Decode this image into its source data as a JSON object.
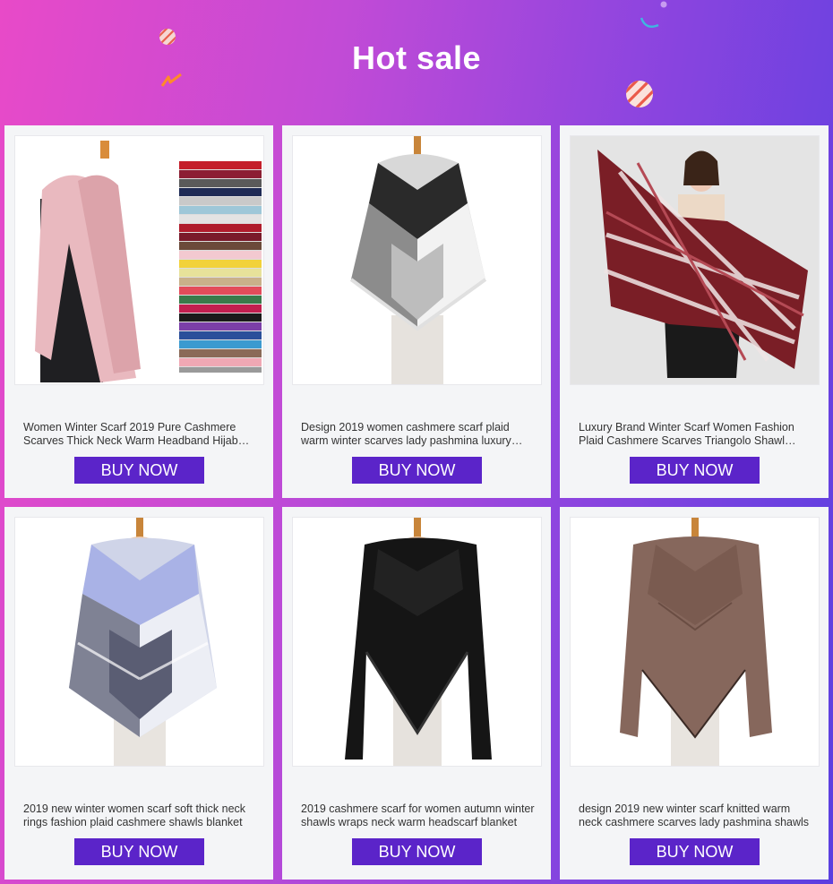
{
  "header": {
    "title": "Hot sale"
  },
  "products": [
    {
      "description": "Women Winter Scarf 2019 Pure Cashmere Scarves Thick Neck Warm Headband Hijab Shawls",
      "button": "BUY NOW",
      "image": "pink-cashmere-scarf-with-color-swatches"
    },
    {
      "description": "Design 2019 women cashmere scarf plaid warm winter scarves lady pashmina luxury brand",
      "button": "BUY NOW",
      "image": "grey-white-plaid-triangle-scarf-on-mannequin"
    },
    {
      "description": "Luxury Brand Winter Scarf Women Fashion Plaid Cashmere Scarves Triangolo Shawl Wraps",
      "button": "BUY NOW",
      "image": "model-holding-burgundy-plaid-scarf"
    },
    {
      "description": "2019 new winter women scarf soft thick neck rings fashion plaid cashmere shawls blanket",
      "button": "BUY NOW",
      "image": "lavender-grey-plaid-triangle-scarf"
    },
    {
      "description": "2019 cashmere scarf for women autumn winter shawls wraps neck warm headscarf blanket",
      "button": "BUY NOW",
      "image": "black-triangle-scarf-on-mannequin"
    },
    {
      "description": "design 2019 new winter scarf knitted warm neck cashmere scarves lady pashmina shawls",
      "button": "BUY NOW",
      "image": "brown-knitted-triangle-scarf"
    }
  ],
  "colors": {
    "accent": "#5b24c9",
    "card_bg": "#f4f5f7",
    "gradient_left": "#e84ac8",
    "gradient_right": "#5a3fe0"
  }
}
